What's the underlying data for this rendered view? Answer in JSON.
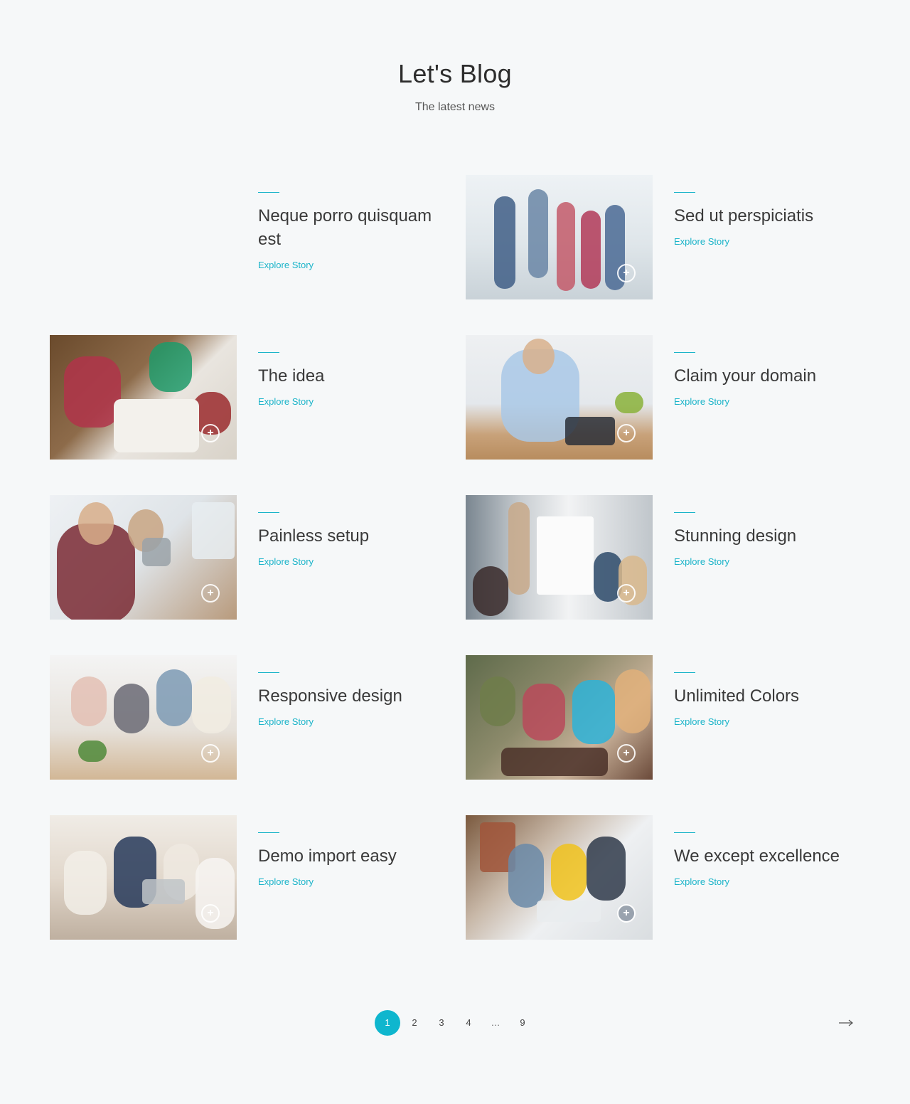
{
  "header": {
    "title": "Let's Blog",
    "subtitle": "The latest news"
  },
  "posts": [
    {
      "title": "Neque porro quisquam est",
      "link": "Explore Story",
      "has_image": false
    },
    {
      "title": "Sed ut perspiciatis",
      "link": "Explore Story",
      "has_image": true,
      "image": "students-jumping"
    },
    {
      "title": "The idea",
      "link": "Explore Story",
      "has_image": true,
      "image": "team-brainstorm"
    },
    {
      "title": "Claim your domain",
      "link": "Explore Story",
      "has_image": true,
      "image": "man-on-phone"
    },
    {
      "title": "Painless setup",
      "link": "Explore Story",
      "has_image": true,
      "image": "smiling-man-office"
    },
    {
      "title": "Stunning design",
      "link": "Explore Story",
      "has_image": true,
      "image": "whiteboard-presentation"
    },
    {
      "title": "Responsive design",
      "link": "Explore Story",
      "has_image": true,
      "image": "team-at-laptop"
    },
    {
      "title": "Unlimited Colors",
      "link": "Explore Story",
      "has_image": true,
      "image": "friends-with-phones"
    },
    {
      "title": "Demo import easy",
      "link": "Explore Story",
      "has_image": true,
      "image": "business-meeting"
    },
    {
      "title": "We except excellence",
      "link": "Explore Story",
      "has_image": true,
      "image": "group-at-laptop"
    }
  ],
  "pagination": {
    "pages": [
      "1",
      "2",
      "3",
      "4",
      "…",
      "9"
    ],
    "current": "1",
    "next_icon": "arrow-right-icon"
  },
  "colors": {
    "accent": "#0fb6ce",
    "link": "#1bb4c9",
    "background": "#f6f8f9"
  }
}
